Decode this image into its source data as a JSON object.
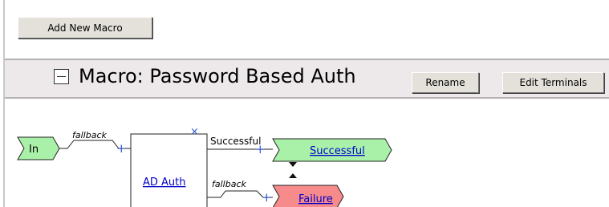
{
  "toolbar": {
    "add_macro_label": "Add New Macro"
  },
  "macro": {
    "title": "Macro: Password Based Auth",
    "rename_label": "Rename",
    "edit_terminals_label": "Edit Terminals"
  },
  "flow": {
    "in_label": "In",
    "in_branch_label": "fallback",
    "node_label": "AD Auth",
    "success_branch_label": "Successful",
    "success_terminal_label": "Successful",
    "fallback_branch_label": "fallback",
    "failure_terminal_label": "Failure",
    "plus_symbol": "+",
    "close_symbol": "×"
  },
  "colors": {
    "success_fill": "#a9f1a9",
    "failure_fill": "#f78a8a",
    "link": "#0000cc",
    "header_bg": "#ede9eb"
  }
}
